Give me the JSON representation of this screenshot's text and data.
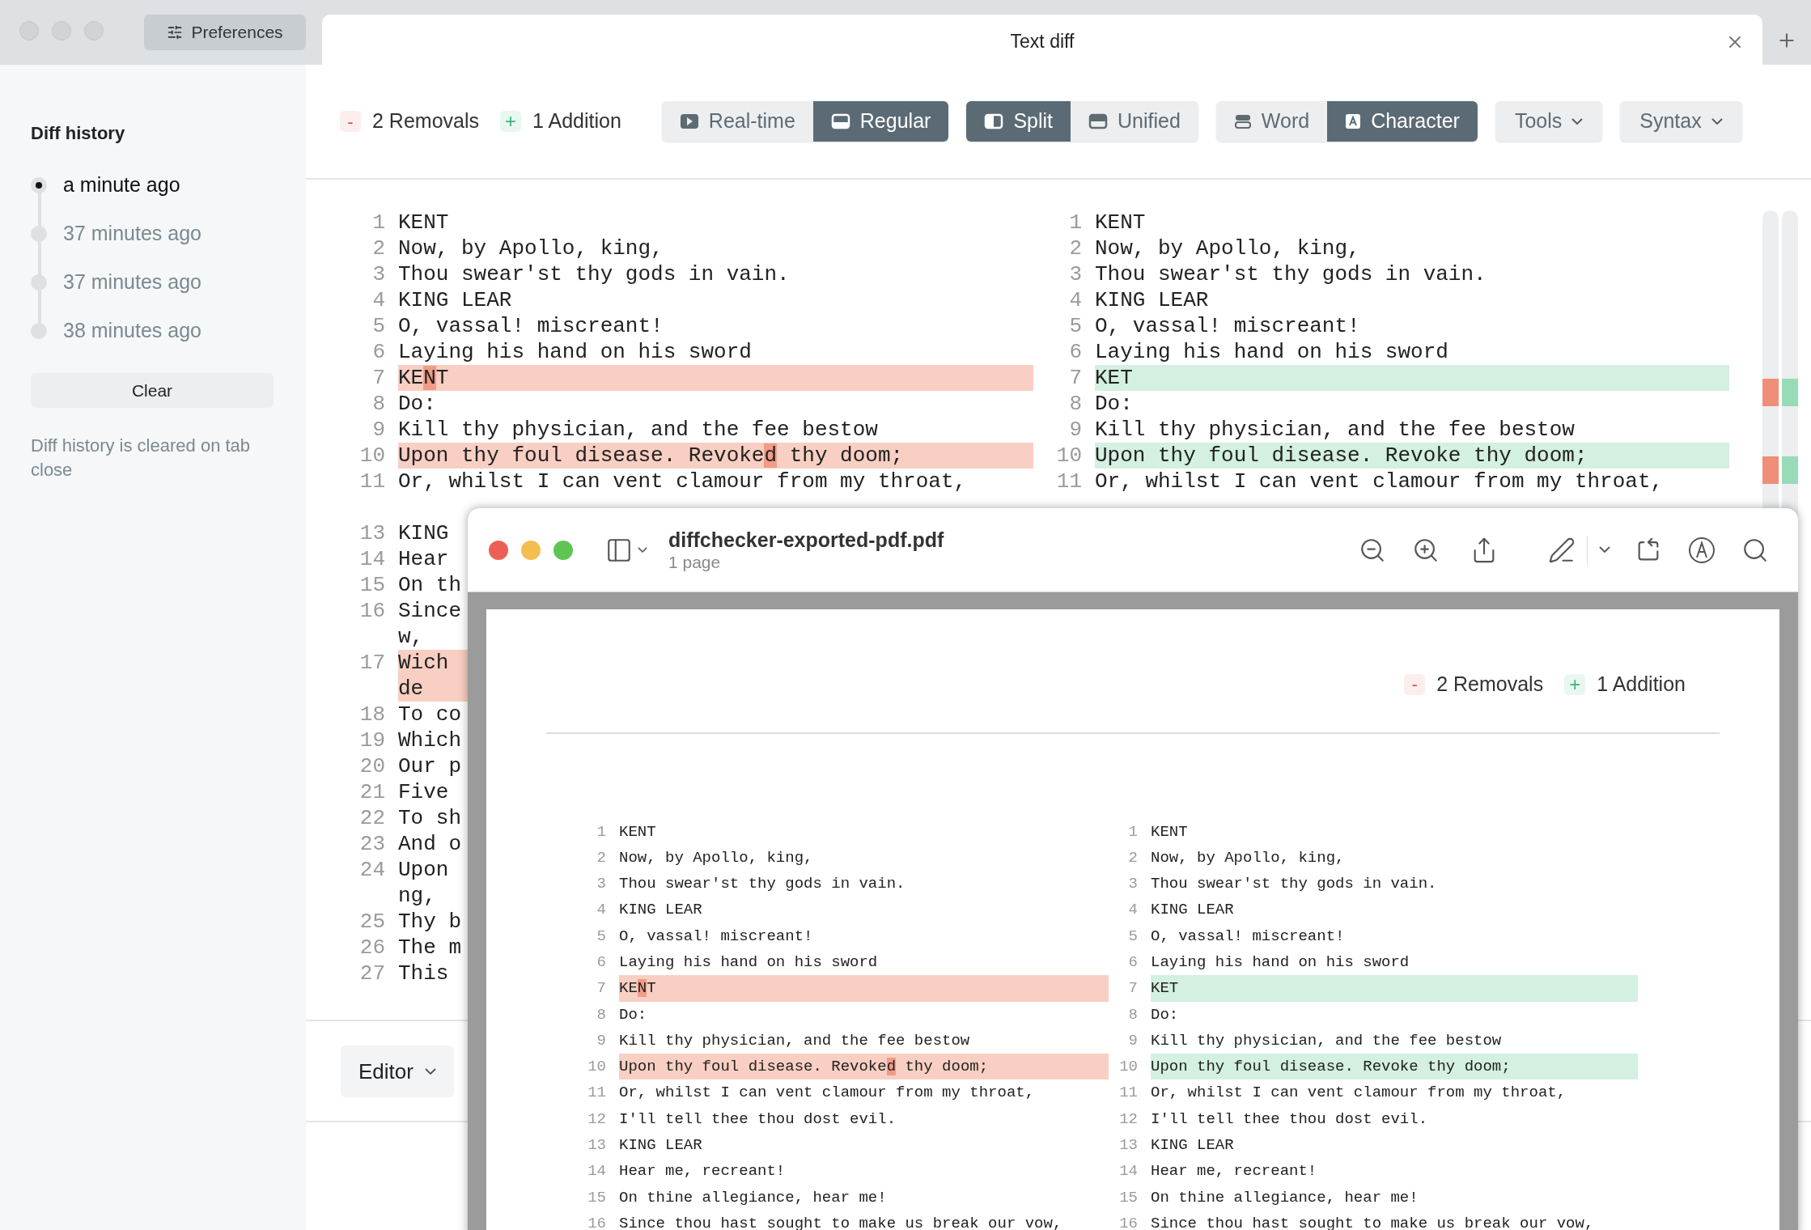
{
  "app": {
    "preferences_button": "Preferences",
    "tab": {
      "title": "Text diff"
    }
  },
  "sidebar": {
    "title": "Diff history",
    "items": [
      {
        "label": "a minute ago",
        "selected": true
      },
      {
        "label": "37 minutes ago",
        "selected": false
      },
      {
        "label": "37 minutes ago",
        "selected": false
      },
      {
        "label": "38 minutes ago",
        "selected": false
      }
    ],
    "clear_button": "Clear",
    "note": "Diff history is cleared on tab close"
  },
  "toolbar": {
    "removals": {
      "sign": "-",
      "label": "2 Removals"
    },
    "additions": {
      "sign": "+",
      "label": "1 Addition"
    },
    "groups": [
      [
        {
          "label": "Real-time",
          "selected": false
        },
        {
          "label": "Regular",
          "selected": true
        }
      ],
      [
        {
          "label": "Split",
          "selected": true
        },
        {
          "label": "Unified",
          "selected": false
        }
      ],
      [
        {
          "label": "Word",
          "selected": false
        },
        {
          "label": "Character",
          "selected": true
        }
      ]
    ],
    "menus": [
      "Tools",
      "Syntax"
    ]
  },
  "diff": {
    "left": [
      {
        "num": "1",
        "kind": "same",
        "text": "KENT"
      },
      {
        "num": "2",
        "kind": "same",
        "text": "Now, by Apollo, king,"
      },
      {
        "num": "3",
        "kind": "same",
        "text": "Thou swear'st thy gods in vain."
      },
      {
        "num": "4",
        "kind": "same",
        "text": "KING LEAR"
      },
      {
        "num": "5",
        "kind": "same",
        "text": "O, vassal! miscreant!"
      },
      {
        "num": "6",
        "kind": "same",
        "text": "Laying his hand on his sword"
      },
      {
        "num": "7",
        "kind": "removed",
        "segments": [
          {
            "text": "KE",
            "changed": false
          },
          {
            "text": "N",
            "changed": true
          },
          {
            "text": "T",
            "changed": false
          }
        ]
      },
      {
        "num": "8",
        "kind": "same",
        "text": "Do:"
      },
      {
        "num": "9",
        "kind": "same",
        "text": "Kill thy physician, and the fee bestow"
      },
      {
        "num": "10",
        "kind": "removed",
        "segments": [
          {
            "text": "Upon thy foul disease. Revoke",
            "changed": false
          },
          {
            "text": "d",
            "changed": true
          },
          {
            "text": " thy doom;",
            "changed": false
          }
        ]
      },
      {
        "num": "11",
        "kind": "same",
        "text": "Or, whilst I can vent clamour from my throat,"
      },
      {
        "num": "13",
        "kind": "same",
        "text": "KING"
      },
      {
        "num": "14",
        "kind": "same",
        "text": "Hear"
      },
      {
        "num": "15",
        "kind": "same",
        "text": "On th"
      },
      {
        "num": "16",
        "kind": "same",
        "text": "Since",
        "wrap": "w,"
      },
      {
        "num": "17",
        "kind": "removed",
        "text": "Wich",
        "wrap": "de"
      },
      {
        "num": "18",
        "kind": "same",
        "text": "To co"
      },
      {
        "num": "19",
        "kind": "same",
        "text": "Which"
      },
      {
        "num": "20",
        "kind": "same",
        "text": "Our p"
      },
      {
        "num": "21",
        "kind": "same",
        "text": "Five"
      },
      {
        "num": "22",
        "kind": "same",
        "text": "To sh"
      },
      {
        "num": "23",
        "kind": "same",
        "text": "And o"
      },
      {
        "num": "24",
        "kind": "same",
        "text": "Upon",
        "wrap": "ng,"
      },
      {
        "num": "25",
        "kind": "same",
        "text": "Thy b"
      },
      {
        "num": "26",
        "kind": "same",
        "text": "The m"
      },
      {
        "num": "27",
        "kind": "same",
        "text": "This"
      }
    ],
    "right": [
      {
        "num": "1",
        "kind": "same",
        "text": "KENT"
      },
      {
        "num": "2",
        "kind": "same",
        "text": "Now, by Apollo, king,"
      },
      {
        "num": "3",
        "kind": "same",
        "text": "Thou swear'st thy gods in vain."
      },
      {
        "num": "4",
        "kind": "same",
        "text": "KING LEAR"
      },
      {
        "num": "5",
        "kind": "same",
        "text": "O, vassal! miscreant!"
      },
      {
        "num": "6",
        "kind": "same",
        "text": "Laying his hand on his sword"
      },
      {
        "num": "7",
        "kind": "added",
        "text": "KET"
      },
      {
        "num": "8",
        "kind": "same",
        "text": "Do:"
      },
      {
        "num": "9",
        "kind": "same",
        "text": "Kill thy physician, and the fee bestow"
      },
      {
        "num": "10",
        "kind": "added",
        "text": "Upon thy foul disease. Revoke thy doom;"
      },
      {
        "num": "11",
        "kind": "same",
        "text": "Or, whilst I can vent clamour from my throat,"
      }
    ]
  },
  "editor_menu": "Editor",
  "pdf_viewer": {
    "title": "diffchecker-exported-pdf.pdf",
    "subtitle": "1 page",
    "removals": {
      "sign": "-",
      "label": "2 Removals"
    },
    "additions": {
      "sign": "+",
      "label": "1 Addition"
    },
    "left": [
      {
        "num": "1",
        "kind": "same",
        "text": "KENT"
      },
      {
        "num": "2",
        "kind": "same",
        "text": "Now, by Apollo, king,"
      },
      {
        "num": "3",
        "kind": "same",
        "text": "Thou swear'st thy gods in vain."
      },
      {
        "num": "4",
        "kind": "same",
        "text": "KING LEAR"
      },
      {
        "num": "5",
        "kind": "same",
        "text": "O, vassal! miscreant!"
      },
      {
        "num": "6",
        "kind": "same",
        "text": "Laying his hand on his sword"
      },
      {
        "num": "7",
        "kind": "removed",
        "segments": [
          {
            "text": "KE",
            "changed": false
          },
          {
            "text": "N",
            "changed": true
          },
          {
            "text": "T",
            "changed": false
          }
        ]
      },
      {
        "num": "8",
        "kind": "same",
        "text": "Do:"
      },
      {
        "num": "9",
        "kind": "same",
        "text": "Kill thy physician, and the fee bestow"
      },
      {
        "num": "10",
        "kind": "removed",
        "segments": [
          {
            "text": "Upon thy foul disease. Revoke",
            "changed": false
          },
          {
            "text": "d",
            "changed": true
          },
          {
            "text": " thy doom;",
            "changed": false
          }
        ]
      },
      {
        "num": "11",
        "kind": "same",
        "text": "Or, whilst I can vent clamour from my throat,"
      },
      {
        "num": "12",
        "kind": "same",
        "text": "I'll tell thee thou dost evil."
      },
      {
        "num": "13",
        "kind": "same",
        "text": "KING LEAR"
      },
      {
        "num": "14",
        "kind": "same",
        "text": "Hear me, recreant!"
      },
      {
        "num": "15",
        "kind": "same",
        "text": "On thine allegiance, hear me!"
      },
      {
        "num": "16",
        "kind": "same",
        "text": "Since thou hast sought to make us break our vow,"
      }
    ],
    "right": [
      {
        "num": "1",
        "kind": "same",
        "text": "KENT"
      },
      {
        "num": "2",
        "kind": "same",
        "text": "Now, by Apollo, king,"
      },
      {
        "num": "3",
        "kind": "same",
        "text": "Thou swear'st thy gods in vain."
      },
      {
        "num": "4",
        "kind": "same",
        "text": "KING LEAR"
      },
      {
        "num": "5",
        "kind": "same",
        "text": "O, vassal! miscreant!"
      },
      {
        "num": "6",
        "kind": "same",
        "text": "Laying his hand on his sword"
      },
      {
        "num": "7",
        "kind": "added",
        "text": "KET"
      },
      {
        "num": "8",
        "kind": "same",
        "text": "Do:"
      },
      {
        "num": "9",
        "kind": "same",
        "text": "Kill thy physician, and the fee bestow"
      },
      {
        "num": "10",
        "kind": "added",
        "text": "Upon thy foul disease. Revoke thy doom;"
      },
      {
        "num": "11",
        "kind": "same",
        "text": "Or, whilst I can vent clamour from my throat,"
      },
      {
        "num": "12",
        "kind": "same",
        "text": "I'll tell thee thou dost evil."
      },
      {
        "num": "13",
        "kind": "same",
        "text": "KING LEAR"
      },
      {
        "num": "14",
        "kind": "same",
        "text": "Hear me, recreant!"
      },
      {
        "num": "15",
        "kind": "same",
        "text": "On thine allegiance, hear me!"
      },
      {
        "num": "16",
        "kind": "same",
        "text": "Since thou hast sought to make us break our vow,"
      }
    ]
  }
}
